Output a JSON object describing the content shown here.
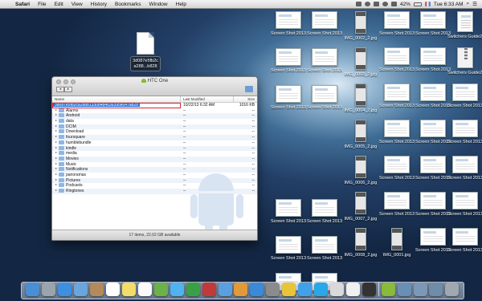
{
  "menubar": {
    "apple": "",
    "items": [
      "Safari",
      "File",
      "Edit",
      "View",
      "History",
      "Bookmarks",
      "Window",
      "Help"
    ],
    "battery": "42%",
    "clock": "Tue 6:33 AM"
  },
  "dragged_file": {
    "label_line1": "3d087e5fb2c",
    "label_line2": "a288...b828"
  },
  "window": {
    "title": "HTC One",
    "back": "◂",
    "forward": "▸",
    "columns": {
      "name": "Name",
      "modified": "Last Modified",
      "size": "Size"
    },
    "first_row": {
      "name": "3d087e5fb2ca28881330b4d4636395e047a828",
      "modified": "10/22/13 6:32 AM",
      "size": "1016 KB"
    },
    "folders": [
      {
        "name": "Alarms",
        "modified": "--",
        "size": "--"
      },
      {
        "name": "Android",
        "modified": "--",
        "size": "--"
      },
      {
        "name": "data",
        "modified": "--",
        "size": "--"
      },
      {
        "name": "DCIM",
        "modified": "--",
        "size": "--"
      },
      {
        "name": "Download",
        "modified": "--",
        "size": "--"
      },
      {
        "name": "foursquare",
        "modified": "--",
        "size": "--"
      },
      {
        "name": "humblebundle",
        "modified": "--",
        "size": "--"
      },
      {
        "name": "kindle",
        "modified": "--",
        "size": "--"
      },
      {
        "name": "media",
        "modified": "--",
        "size": "--"
      },
      {
        "name": "Movies",
        "modified": "--",
        "size": "--"
      },
      {
        "name": "Music",
        "modified": "--",
        "size": "--"
      },
      {
        "name": "Notifications",
        "modified": "--",
        "size": "--"
      },
      {
        "name": "panoramas",
        "modified": "--",
        "size": "--"
      },
      {
        "name": "Pictures",
        "modified": "--",
        "size": "--"
      },
      {
        "name": "Podcasts",
        "modified": "--",
        "size": "--"
      },
      {
        "name": "Ringtones",
        "modified": "--",
        "size": "--"
      }
    ],
    "status": "17 items, 22.02 GB available"
  },
  "desktop": {
    "col1": [
      {
        "label": "Screen Shot 2013...0 PM",
        "kind": "shot"
      },
      {
        "label": "Screen Shot 2013...0 AM",
        "kind": "shot"
      },
      {
        "label": "Screen Shot 2013...8 AM",
        "kind": "shot"
      },
      {
        "label": "Screen Shot 2013...8 AM",
        "kind": "shot"
      },
      {
        "label": "Screen Shot 2013...3 AM",
        "kind": "shot"
      },
      {
        "label": "Screen Shot 2013...0 PM",
        "kind": "shot"
      }
    ],
    "col2": [
      {
        "label": "Screen Shot 2013...0 PM",
        "kind": "shot"
      },
      {
        "label": "Screen Shot 2013...5 AM",
        "kind": "shot"
      },
      {
        "label": "Screen Shot 2013...8 AM",
        "kind": "shot"
      },
      {
        "label": "Screen Shot 2013...3 AM",
        "kind": "shot"
      },
      {
        "label": "Screen Shot 2013...1 PM",
        "kind": "shot"
      },
      {
        "label": "Screen Shot 2013...0 PM",
        "kind": "shot"
      }
    ],
    "col3": [
      {
        "label": "IMG_0002_2.jpg",
        "kind": "phone"
      },
      {
        "label": "IMG_0003_2.jpg",
        "kind": "phone"
      },
      {
        "label": "IMG_0004_2.jpg",
        "kind": "phone"
      },
      {
        "label": "IMG_0005_2.jpg",
        "kind": "phone"
      },
      {
        "label": "IMG_0006_2.jpg",
        "kind": "phone"
      },
      {
        "label": "IMG_0007_2.jpg",
        "kind": "phone"
      },
      {
        "label": "IMG_0008_2.jpg",
        "kind": "phone"
      }
    ],
    "col4": [
      {
        "label": "Screen Shot 2013...0 AM",
        "kind": "shot"
      },
      {
        "label": "Screen Shot 2013...1 PM",
        "kind": "shot"
      },
      {
        "label": "Screen Shot 2013...1 AM",
        "kind": "shot"
      },
      {
        "label": "Screen Shot 2013...5 PM",
        "kind": "shot"
      },
      {
        "label": "Screen Shot 2013...1 PM*",
        "kind": "shot"
      },
      {
        "label": "Screen Shot 2013...2 PM",
        "kind": "shot"
      },
      {
        "label": "IMG_0001.jpg",
        "kind": "phone"
      }
    ],
    "col5": [
      {
        "label": "Screen Shot 2013...0 AM",
        "kind": "shot"
      },
      {
        "label": "Screen Shot 2013...9 PM",
        "kind": "shot"
      },
      {
        "label": "Screen Shot 2013...2 PM",
        "kind": "shot"
      },
      {
        "label": "Screen Shot 2013...8 PM",
        "kind": "shot"
      },
      {
        "label": "Screen Shot 2013...0 PM",
        "kind": "shot"
      },
      {
        "label": "Screen Shot 2013...8 PM",
        "kind": "shot"
      },
      {
        "label": "Screen Shot 2013...0 PM",
        "kind": "shot"
      }
    ],
    "col6": [
      {
        "label": "Switchers Guide2.jpg",
        "kind": "doc"
      },
      {
        "label": "Switchers Guide2.zip",
        "kind": "zip"
      },
      {
        "label": "Screen Shot 2013...9 PM",
        "kind": "shot"
      },
      {
        "label": "Screen Shot 2013...1 PM",
        "kind": "shot"
      },
      {
        "label": "Screen Shot 2013...5 PM",
        "kind": "shot"
      },
      {
        "label": "Screen Shot 2013...2 PM",
        "kind": "shot"
      },
      {
        "label": "Screen Shot 2013...4 PM",
        "kind": "shot"
      }
    ]
  },
  "dock": {
    "icons": [
      "finder-icon",
      "launchpad-icon",
      "safari-icon",
      "mail-icon",
      "contacts-icon",
      "calendar-icon",
      "notes-icon",
      "reminders-icon",
      "maps-icon",
      "messages-icon",
      "facetime-icon",
      "photo-booth-icon",
      "itunes-icon",
      "ibooks-icon",
      "app-store-icon",
      "system-prefs-icon",
      "chrome-icon",
      "twitter-icon",
      "skype-icon",
      "preview-icon",
      "textedit-icon",
      "terminal-icon",
      "android-transfer-icon",
      "downloads-icon",
      "documents-icon",
      "applications-icon",
      "trash-icon"
    ],
    "colors": [
      "#4a8fd6",
      "#9aa4ad",
      "#3f8fe0",
      "#6aa6dc",
      "#b38a5c",
      "#ffffff",
      "#f2dc6a",
      "#fafafa",
      "#6cb14a",
      "#4fb3f0",
      "#3aa045",
      "#c03a3a",
      "#5a9fe0",
      "#e09a3a",
      "#3a8ad8",
      "#8b8b8b",
      "#e8c43a",
      "#41a1e8",
      "#2aa7e8",
      "#d9d9d9",
      "#f0f0f0",
      "#333333",
      "#8ab93b",
      "#6a8fb5",
      "#7d98b7",
      "#6f8ca8",
      "#a0a8b0"
    ]
  }
}
